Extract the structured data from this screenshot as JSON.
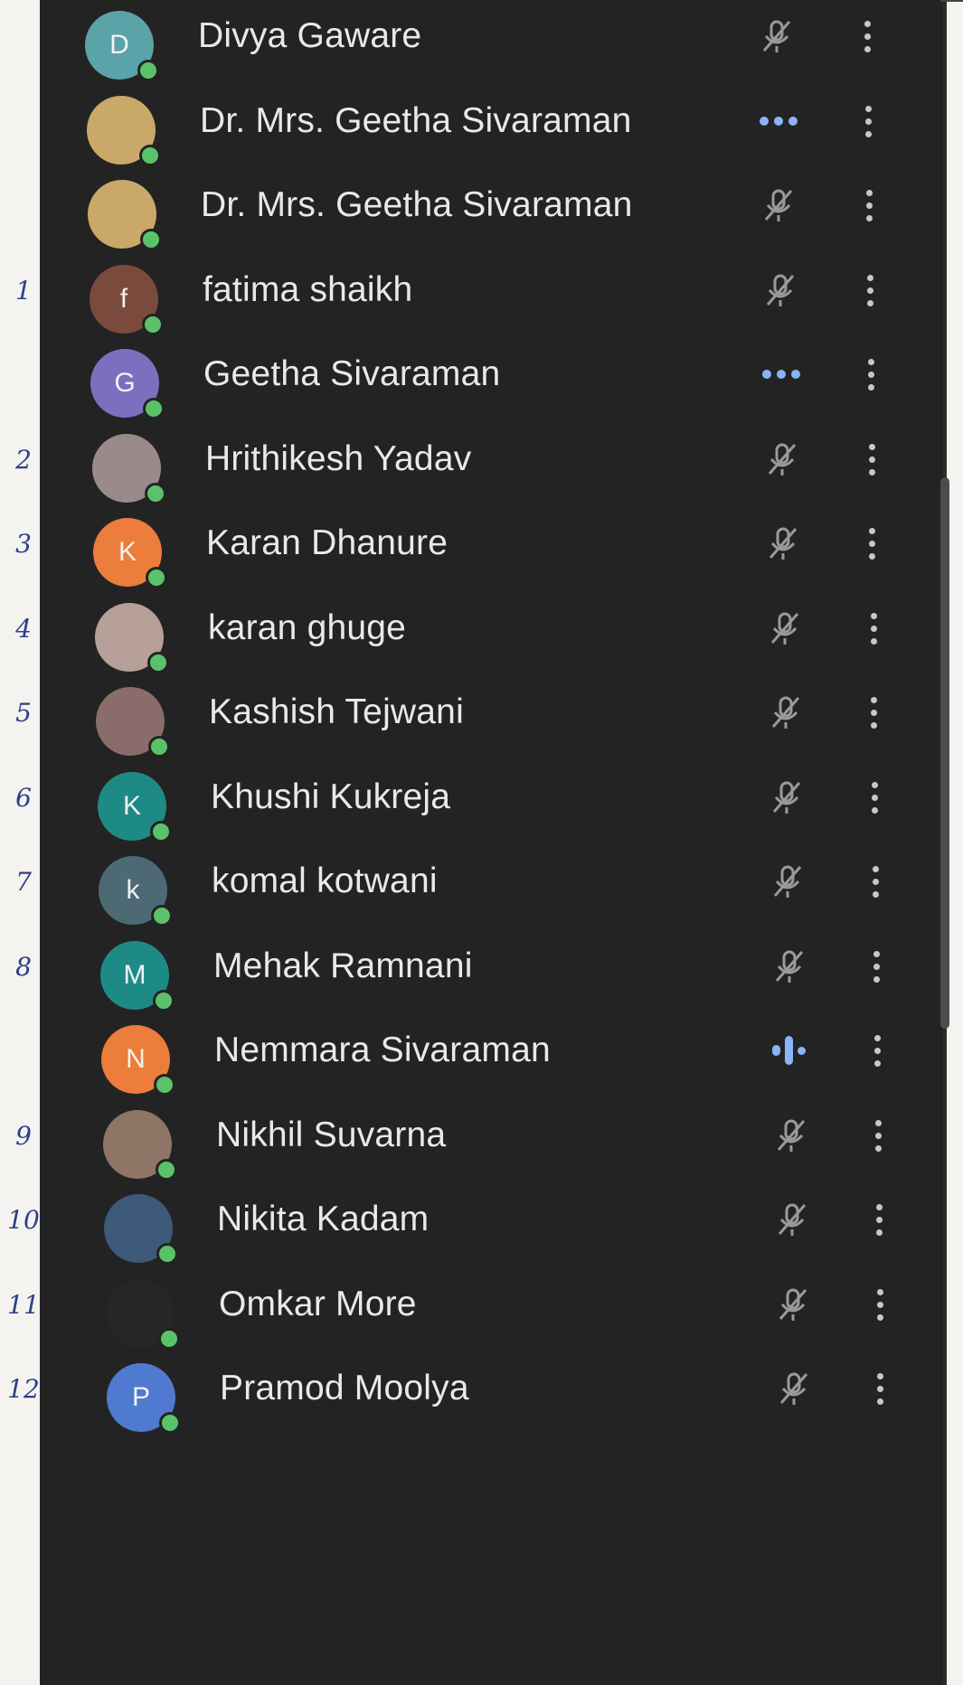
{
  "participants": [
    {
      "name": "Divya Gaware",
      "initial": "D",
      "avatar_color": "#5aa3a8",
      "status": "muted",
      "note": ""
    },
    {
      "name": "Dr. Mrs. Geetha Sivaraman",
      "initial": "",
      "avatar_color": "#c9a86a",
      "status": "more",
      "note": ""
    },
    {
      "name": "Dr. Mrs. Geetha Sivaraman",
      "initial": "",
      "avatar_color": "#c9a86a",
      "status": "muted",
      "note": ""
    },
    {
      "name": "fatima shaikh",
      "initial": "f",
      "avatar_color": "#7a4b3c",
      "status": "muted",
      "note": "1"
    },
    {
      "name": "Geetha Sivaraman",
      "initial": "G",
      "avatar_color": "#7b6fc0",
      "status": "more",
      "note": ""
    },
    {
      "name": "Hrithikesh Yadav",
      "initial": "",
      "avatar_color": "#9a8a8c",
      "status": "muted",
      "note": "2"
    },
    {
      "name": "Karan Dhanure",
      "initial": "K",
      "avatar_color": "#ec7d3a",
      "status": "muted",
      "note": "3"
    },
    {
      "name": "karan ghuge",
      "initial": "",
      "avatar_color": "#b7a09a",
      "status": "muted",
      "note": "4"
    },
    {
      "name": "Kashish Tejwani",
      "initial": "",
      "avatar_color": "#8a6d6a",
      "status": "muted",
      "note": "5"
    },
    {
      "name": "Khushi Kukreja",
      "initial": "K",
      "avatar_color": "#1e8a86",
      "status": "muted",
      "note": "6"
    },
    {
      "name": "komal kotwani",
      "initial": "k",
      "avatar_color": "#4d6a74",
      "status": "muted",
      "note": "7"
    },
    {
      "name": "Mehak Ramnani",
      "initial": "M",
      "avatar_color": "#1e8a86",
      "status": "muted",
      "note": "8"
    },
    {
      "name": "Nemmara Sivaraman",
      "initial": "N",
      "avatar_color": "#ec7d3a",
      "status": "speaking",
      "note": ""
    },
    {
      "name": "Nikhil Suvarna",
      "initial": "",
      "avatar_color": "#8e7566",
      "status": "muted",
      "note": "9"
    },
    {
      "name": "Nikita Kadam",
      "initial": "",
      "avatar_color": "#3d5a7a",
      "status": "muted",
      "note": "10"
    },
    {
      "name": "Omkar More",
      "initial": "",
      "avatar_color": "#262626",
      "status": "muted",
      "note": "11"
    },
    {
      "name": "Pramod Moolya",
      "initial": "P",
      "avatar_color": "#4f7ad0",
      "status": "muted",
      "note": "12"
    }
  ],
  "icons": {
    "muted": "mic-off-icon",
    "more": "more-horizontal-icon",
    "speaking": "audio-level-icon",
    "menu": "more-vertical-icon"
  },
  "colors": {
    "panel_bg": "#232323",
    "accent_blue": "#8ab4f8",
    "online_green": "#5cc26a",
    "muted_icon": "#9a9a9a",
    "handwriting": "#2d3f8a"
  }
}
